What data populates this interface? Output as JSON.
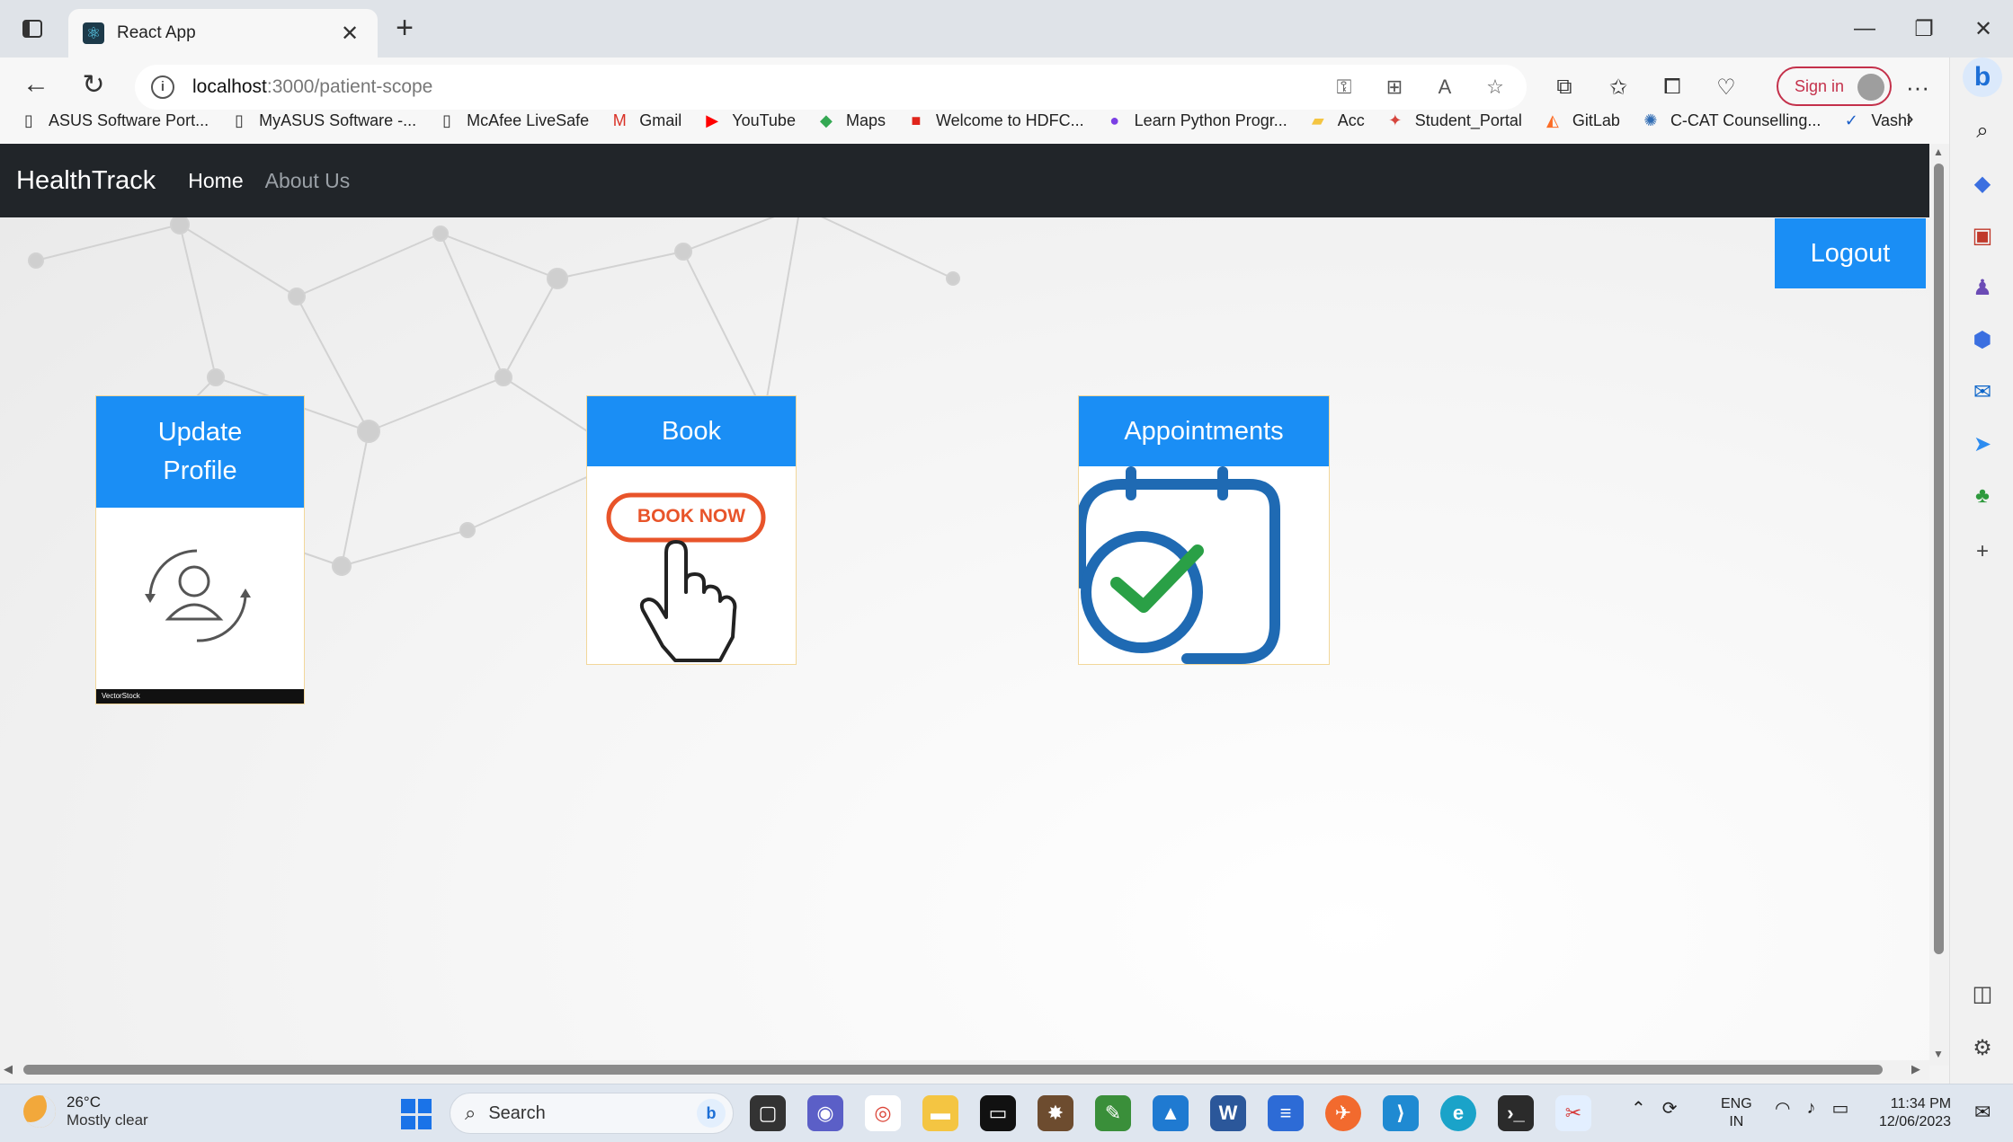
{
  "browser": {
    "tab_title": "React App",
    "tab_close": "✕",
    "new_tab": "+",
    "url_host": "localhost",
    "url_path": ":3000/patient-scope",
    "sign_in": "Sign in",
    "more": "···",
    "window_controls": [
      "—",
      "❐",
      "✕"
    ],
    "bookmarks": [
      {
        "label": "ASUS Software Port...",
        "icon": "page-icon",
        "color": "#333333"
      },
      {
        "label": "MyASUS Software -...",
        "icon": "page-icon",
        "color": "#333333"
      },
      {
        "label": "McAfee LiveSafe",
        "icon": "page-icon",
        "color": "#333333"
      },
      {
        "label": "Gmail",
        "icon": "gmail-icon",
        "color": "#d93025"
      },
      {
        "label": "YouTube",
        "icon": "youtube-icon",
        "color": "#ff0000"
      },
      {
        "label": "Maps",
        "icon": "maps-icon",
        "color": "#34a853"
      },
      {
        "label": "Welcome to HDFC...",
        "icon": "hdfc-icon",
        "color": "#e0241b"
      },
      {
        "label": "Learn Python Progr...",
        "icon": "python-icon",
        "color": "#7b3fe4"
      },
      {
        "label": "Acc",
        "icon": "folder-icon",
        "color": "#f4c542"
      },
      {
        "label": "Student_Portal",
        "icon": "portal-icon",
        "color": "#d6453d"
      },
      {
        "label": "GitLab",
        "icon": "gitlab-icon",
        "color": "#fc6d26"
      },
      {
        "label": "C-CAT Counselling...",
        "icon": "ccat-icon",
        "color": "#2f6bb3"
      },
      {
        "label": "Vashi",
        "icon": "vashi-icon",
        "color": "#1a5ec8"
      }
    ]
  },
  "app": {
    "brand": "HealthTrack",
    "nav": [
      {
        "label": "Home",
        "active": true
      },
      {
        "label": "About Us",
        "active": false
      }
    ],
    "logout_label": "Logout",
    "cards": [
      {
        "title": "Update Profile",
        "image": "profile-update-icon",
        "footer_text": "VectorStock"
      },
      {
        "title": "Book",
        "image": "book-now-icon",
        "image_text": "BOOK NOW"
      },
      {
        "title": "Appointments",
        "image": "calendar-check-icon"
      }
    ],
    "accent_color": "#1a8ef5",
    "navbar_color": "#212529"
  },
  "taskbar": {
    "temperature": "26°C",
    "weather": "Mostly clear",
    "search_label": "Search",
    "lang_line1": "ENG",
    "lang_line2": "IN",
    "time": "11:34 PM",
    "date": "12/06/2023"
  }
}
